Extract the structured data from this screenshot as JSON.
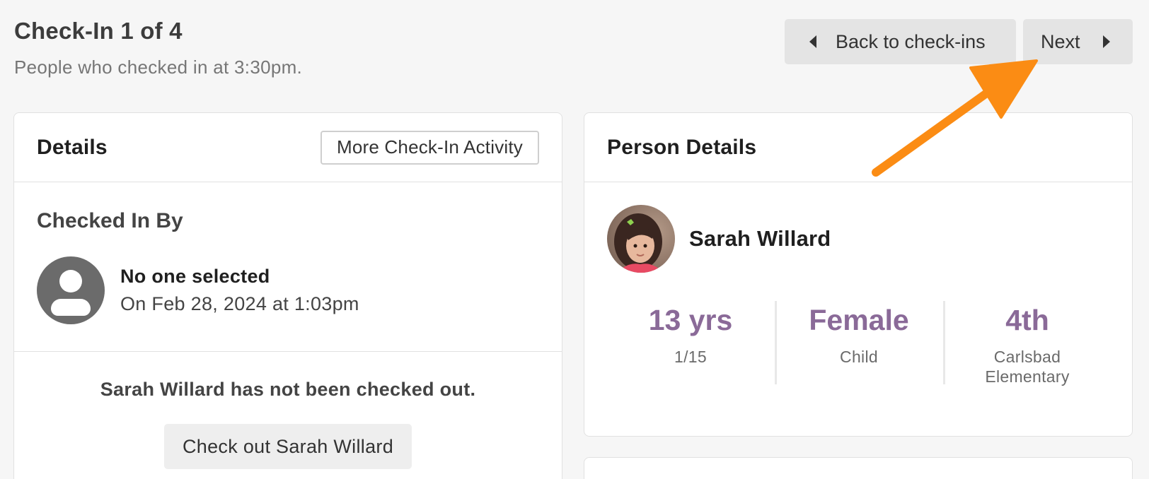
{
  "header": {
    "title": "Check-In 1 of 4",
    "subtitle": "People who checked in at 3:30pm.",
    "back_label": "Back to check-ins",
    "next_label": "Next"
  },
  "details": {
    "title": "Details",
    "activity_button": "More Check-In Activity",
    "checked_in_by_title": "Checked In By",
    "checker_name": "No one selected",
    "checker_date": "On Feb 28, 2024 at 1:03pm",
    "checkout_message": "Sarah Willard has not been checked out.",
    "checkout_button": "Check out Sarah Willard"
  },
  "person": {
    "title": "Person Details",
    "name": "Sarah Willard",
    "stats": [
      {
        "value": "13 yrs",
        "sub": "1/15"
      },
      {
        "value": "Female",
        "sub": "Child"
      },
      {
        "value": "4th",
        "sub": "Carlsbad Elementary"
      }
    ]
  },
  "colors": {
    "accent_purple": "#8a6a98",
    "annotation_orange": "#fb8c14",
    "button_gray": "#e4e4e4"
  },
  "icons": {
    "back": "triangle-left-icon",
    "next": "triangle-right-icon",
    "avatar_placeholder": "user-avatar-icon"
  }
}
